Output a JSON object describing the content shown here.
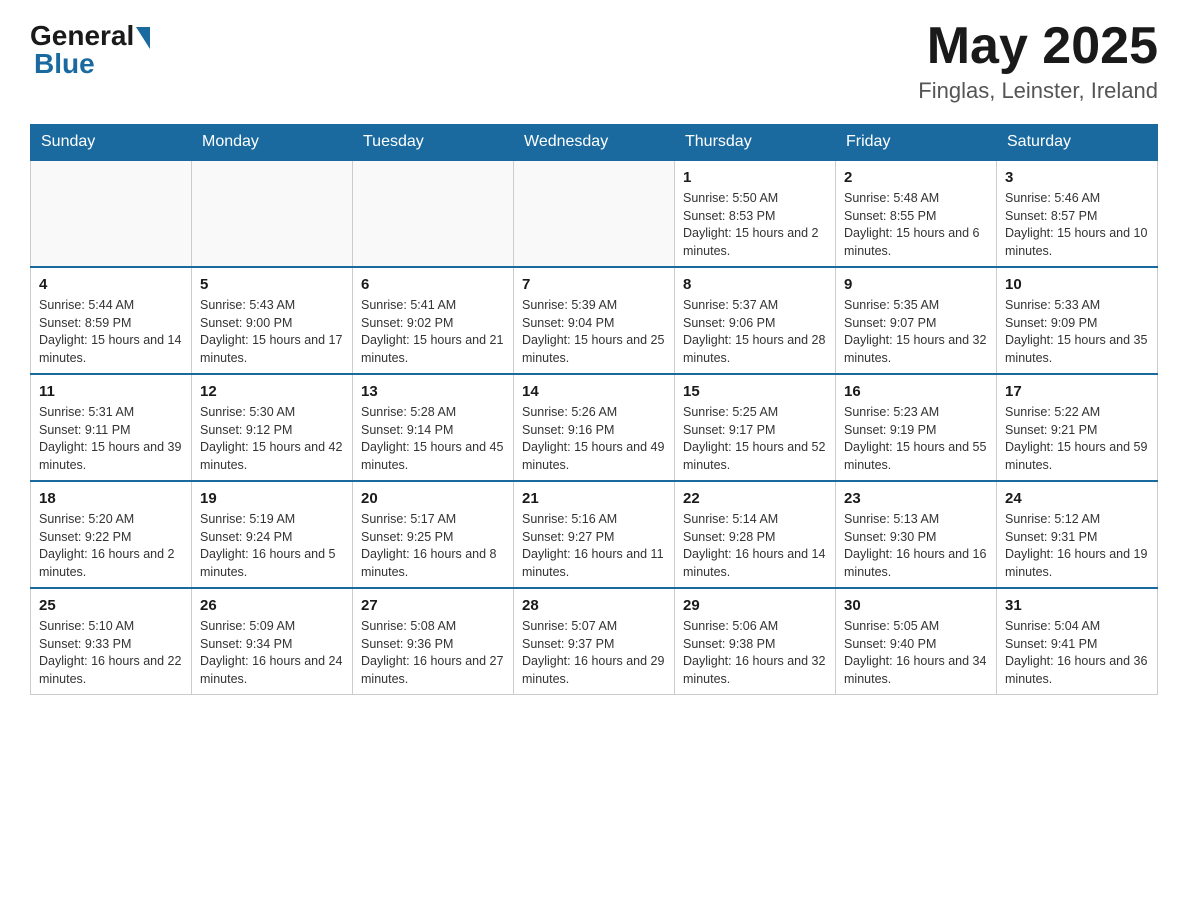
{
  "header": {
    "logo_general": "General",
    "logo_blue": "Blue",
    "month_year": "May 2025",
    "location": "Finglas, Leinster, Ireland"
  },
  "weekdays": [
    "Sunday",
    "Monday",
    "Tuesday",
    "Wednesday",
    "Thursday",
    "Friday",
    "Saturday"
  ],
  "weeks": [
    [
      {
        "day": "",
        "info": ""
      },
      {
        "day": "",
        "info": ""
      },
      {
        "day": "",
        "info": ""
      },
      {
        "day": "",
        "info": ""
      },
      {
        "day": "1",
        "info": "Sunrise: 5:50 AM\nSunset: 8:53 PM\nDaylight: 15 hours and 2 minutes."
      },
      {
        "day": "2",
        "info": "Sunrise: 5:48 AM\nSunset: 8:55 PM\nDaylight: 15 hours and 6 minutes."
      },
      {
        "day": "3",
        "info": "Sunrise: 5:46 AM\nSunset: 8:57 PM\nDaylight: 15 hours and 10 minutes."
      }
    ],
    [
      {
        "day": "4",
        "info": "Sunrise: 5:44 AM\nSunset: 8:59 PM\nDaylight: 15 hours and 14 minutes."
      },
      {
        "day": "5",
        "info": "Sunrise: 5:43 AM\nSunset: 9:00 PM\nDaylight: 15 hours and 17 minutes."
      },
      {
        "day": "6",
        "info": "Sunrise: 5:41 AM\nSunset: 9:02 PM\nDaylight: 15 hours and 21 minutes."
      },
      {
        "day": "7",
        "info": "Sunrise: 5:39 AM\nSunset: 9:04 PM\nDaylight: 15 hours and 25 minutes."
      },
      {
        "day": "8",
        "info": "Sunrise: 5:37 AM\nSunset: 9:06 PM\nDaylight: 15 hours and 28 minutes."
      },
      {
        "day": "9",
        "info": "Sunrise: 5:35 AM\nSunset: 9:07 PM\nDaylight: 15 hours and 32 minutes."
      },
      {
        "day": "10",
        "info": "Sunrise: 5:33 AM\nSunset: 9:09 PM\nDaylight: 15 hours and 35 minutes."
      }
    ],
    [
      {
        "day": "11",
        "info": "Sunrise: 5:31 AM\nSunset: 9:11 PM\nDaylight: 15 hours and 39 minutes."
      },
      {
        "day": "12",
        "info": "Sunrise: 5:30 AM\nSunset: 9:12 PM\nDaylight: 15 hours and 42 minutes."
      },
      {
        "day": "13",
        "info": "Sunrise: 5:28 AM\nSunset: 9:14 PM\nDaylight: 15 hours and 45 minutes."
      },
      {
        "day": "14",
        "info": "Sunrise: 5:26 AM\nSunset: 9:16 PM\nDaylight: 15 hours and 49 minutes."
      },
      {
        "day": "15",
        "info": "Sunrise: 5:25 AM\nSunset: 9:17 PM\nDaylight: 15 hours and 52 minutes."
      },
      {
        "day": "16",
        "info": "Sunrise: 5:23 AM\nSunset: 9:19 PM\nDaylight: 15 hours and 55 minutes."
      },
      {
        "day": "17",
        "info": "Sunrise: 5:22 AM\nSunset: 9:21 PM\nDaylight: 15 hours and 59 minutes."
      }
    ],
    [
      {
        "day": "18",
        "info": "Sunrise: 5:20 AM\nSunset: 9:22 PM\nDaylight: 16 hours and 2 minutes."
      },
      {
        "day": "19",
        "info": "Sunrise: 5:19 AM\nSunset: 9:24 PM\nDaylight: 16 hours and 5 minutes."
      },
      {
        "day": "20",
        "info": "Sunrise: 5:17 AM\nSunset: 9:25 PM\nDaylight: 16 hours and 8 minutes."
      },
      {
        "day": "21",
        "info": "Sunrise: 5:16 AM\nSunset: 9:27 PM\nDaylight: 16 hours and 11 minutes."
      },
      {
        "day": "22",
        "info": "Sunrise: 5:14 AM\nSunset: 9:28 PM\nDaylight: 16 hours and 14 minutes."
      },
      {
        "day": "23",
        "info": "Sunrise: 5:13 AM\nSunset: 9:30 PM\nDaylight: 16 hours and 16 minutes."
      },
      {
        "day": "24",
        "info": "Sunrise: 5:12 AM\nSunset: 9:31 PM\nDaylight: 16 hours and 19 minutes."
      }
    ],
    [
      {
        "day": "25",
        "info": "Sunrise: 5:10 AM\nSunset: 9:33 PM\nDaylight: 16 hours and 22 minutes."
      },
      {
        "day": "26",
        "info": "Sunrise: 5:09 AM\nSunset: 9:34 PM\nDaylight: 16 hours and 24 minutes."
      },
      {
        "day": "27",
        "info": "Sunrise: 5:08 AM\nSunset: 9:36 PM\nDaylight: 16 hours and 27 minutes."
      },
      {
        "day": "28",
        "info": "Sunrise: 5:07 AM\nSunset: 9:37 PM\nDaylight: 16 hours and 29 minutes."
      },
      {
        "day": "29",
        "info": "Sunrise: 5:06 AM\nSunset: 9:38 PM\nDaylight: 16 hours and 32 minutes."
      },
      {
        "day": "30",
        "info": "Sunrise: 5:05 AM\nSunset: 9:40 PM\nDaylight: 16 hours and 34 minutes."
      },
      {
        "day": "31",
        "info": "Sunrise: 5:04 AM\nSunset: 9:41 PM\nDaylight: 16 hours and 36 minutes."
      }
    ]
  ]
}
